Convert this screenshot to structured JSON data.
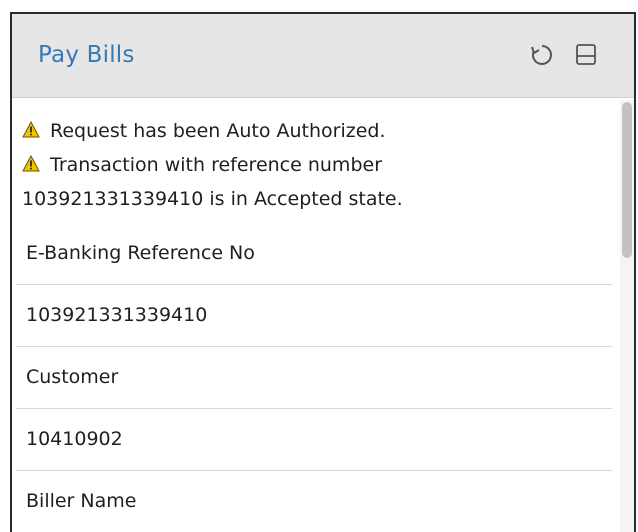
{
  "panel": {
    "title": "Pay Bills",
    "icons": [
      "refresh-icon",
      "minimize-icon"
    ]
  },
  "messages": [
    {
      "icon": "warning-icon",
      "text": "Request has been Auto Authorized."
    },
    {
      "icon": "warning-icon",
      "text": "Transaction with reference number"
    },
    {
      "icon": "",
      "text": "103921331339410 is in Accepted state."
    }
  ],
  "rows": [
    "E-Banking Reference No",
    "103921331339410",
    "Customer",
    "10410902",
    "Biller Name"
  ],
  "colors": {
    "title": "#3778b6",
    "header_bg": "#e6e6e6",
    "warning": "#f2c200"
  }
}
